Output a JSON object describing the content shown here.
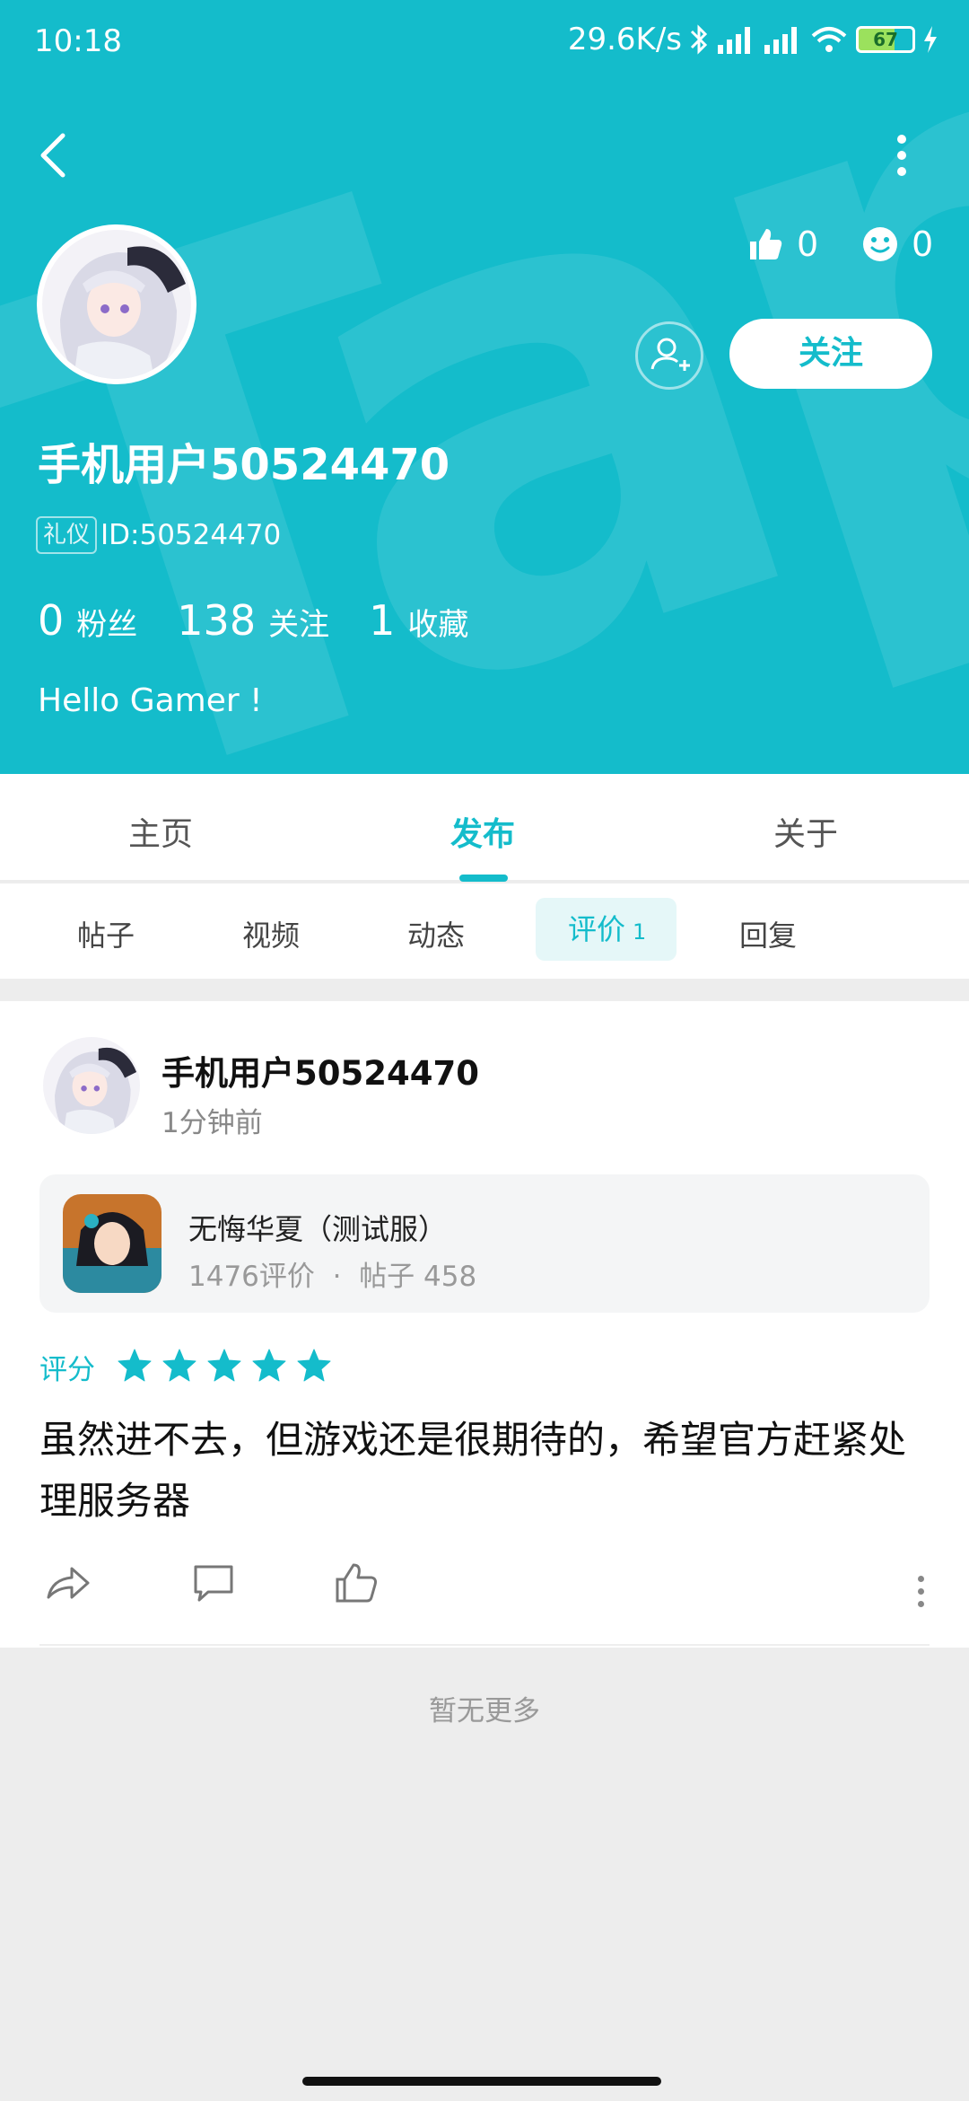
{
  "status_bar": {
    "time": "10:18",
    "speed": "29.6K/s",
    "battery": "67"
  },
  "profile": {
    "username": "手机用户50524470",
    "badge": "礼仪",
    "id_text": "ID:50524470",
    "likes": "0",
    "smiles": "0",
    "follow_label": "关注",
    "stats": [
      {
        "value": "0",
        "label": "粉丝"
      },
      {
        "value": "138",
        "label": "关注"
      },
      {
        "value": "1",
        "label": "收藏"
      }
    ],
    "bio": "Hello Gamer !"
  },
  "tabs": [
    "主页",
    "发布",
    "关于"
  ],
  "active_tab": "发布",
  "subtabs": {
    "posts": "帖子",
    "video": "视频",
    "moments": "动态",
    "reviews": "评价",
    "reviews_count": "1",
    "replies": "回复"
  },
  "review_card": {
    "author": "手机用户50524470",
    "time": "1分钟前",
    "game_name": "无悔华夏（测试服）",
    "game_reviews": "1476评价",
    "game_posts": "帖子 458",
    "rating_label": "评分",
    "rating": 5,
    "text": "虽然进不去，但游戏还是很期待的，希望官方赶紧处理服务器"
  },
  "footer_text": "暂无更多",
  "colors": {
    "accent": "#14bccb",
    "background": "#ededed"
  }
}
